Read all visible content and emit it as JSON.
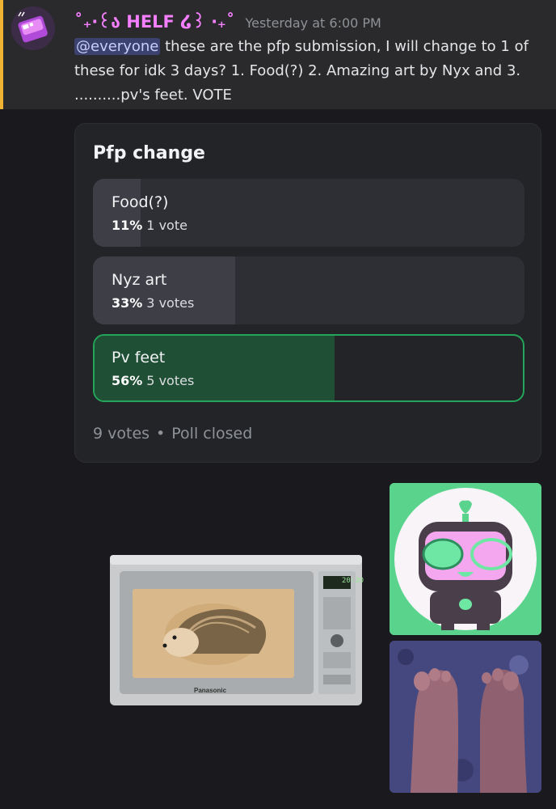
{
  "message": {
    "author": "˚₊‧꒰ა HELF ໒꒱ ‧₊˚",
    "timestamp": "Yesterday at 6:00 PM",
    "mention": "@everyone",
    "text": " these are the pfp submission, I will change to 1 of these for idk 3 days? 1. Food(?) 2. Amazing art by Nyx  and 3. ..........pv's feet. VOTE",
    "accent_color": "#f0b232",
    "author_color": "#f47fff"
  },
  "poll": {
    "question": "Pfp change",
    "options": [
      {
        "label": "Food(?)",
        "percent_text": "11%",
        "votes_text": "1 vote",
        "fraction": 0.11
      },
      {
        "label": "Nyz art",
        "percent_text": "33%",
        "votes_text": "3 votes",
        "fraction": 0.33
      },
      {
        "label": "Pv feet",
        "percent_text": "56%",
        "votes_text": "5 votes",
        "fraction": 0.56,
        "winner": true
      }
    ],
    "total_votes": "9 votes",
    "separator": "•",
    "status": "Poll closed"
  },
  "attachments": {
    "microwave": {
      "brand": "Panasonic",
      "display": "20:30"
    }
  },
  "colors": {
    "background": "#1a1a1e",
    "winner_border": "#23a55a",
    "mention_bg": "#3c4270"
  }
}
